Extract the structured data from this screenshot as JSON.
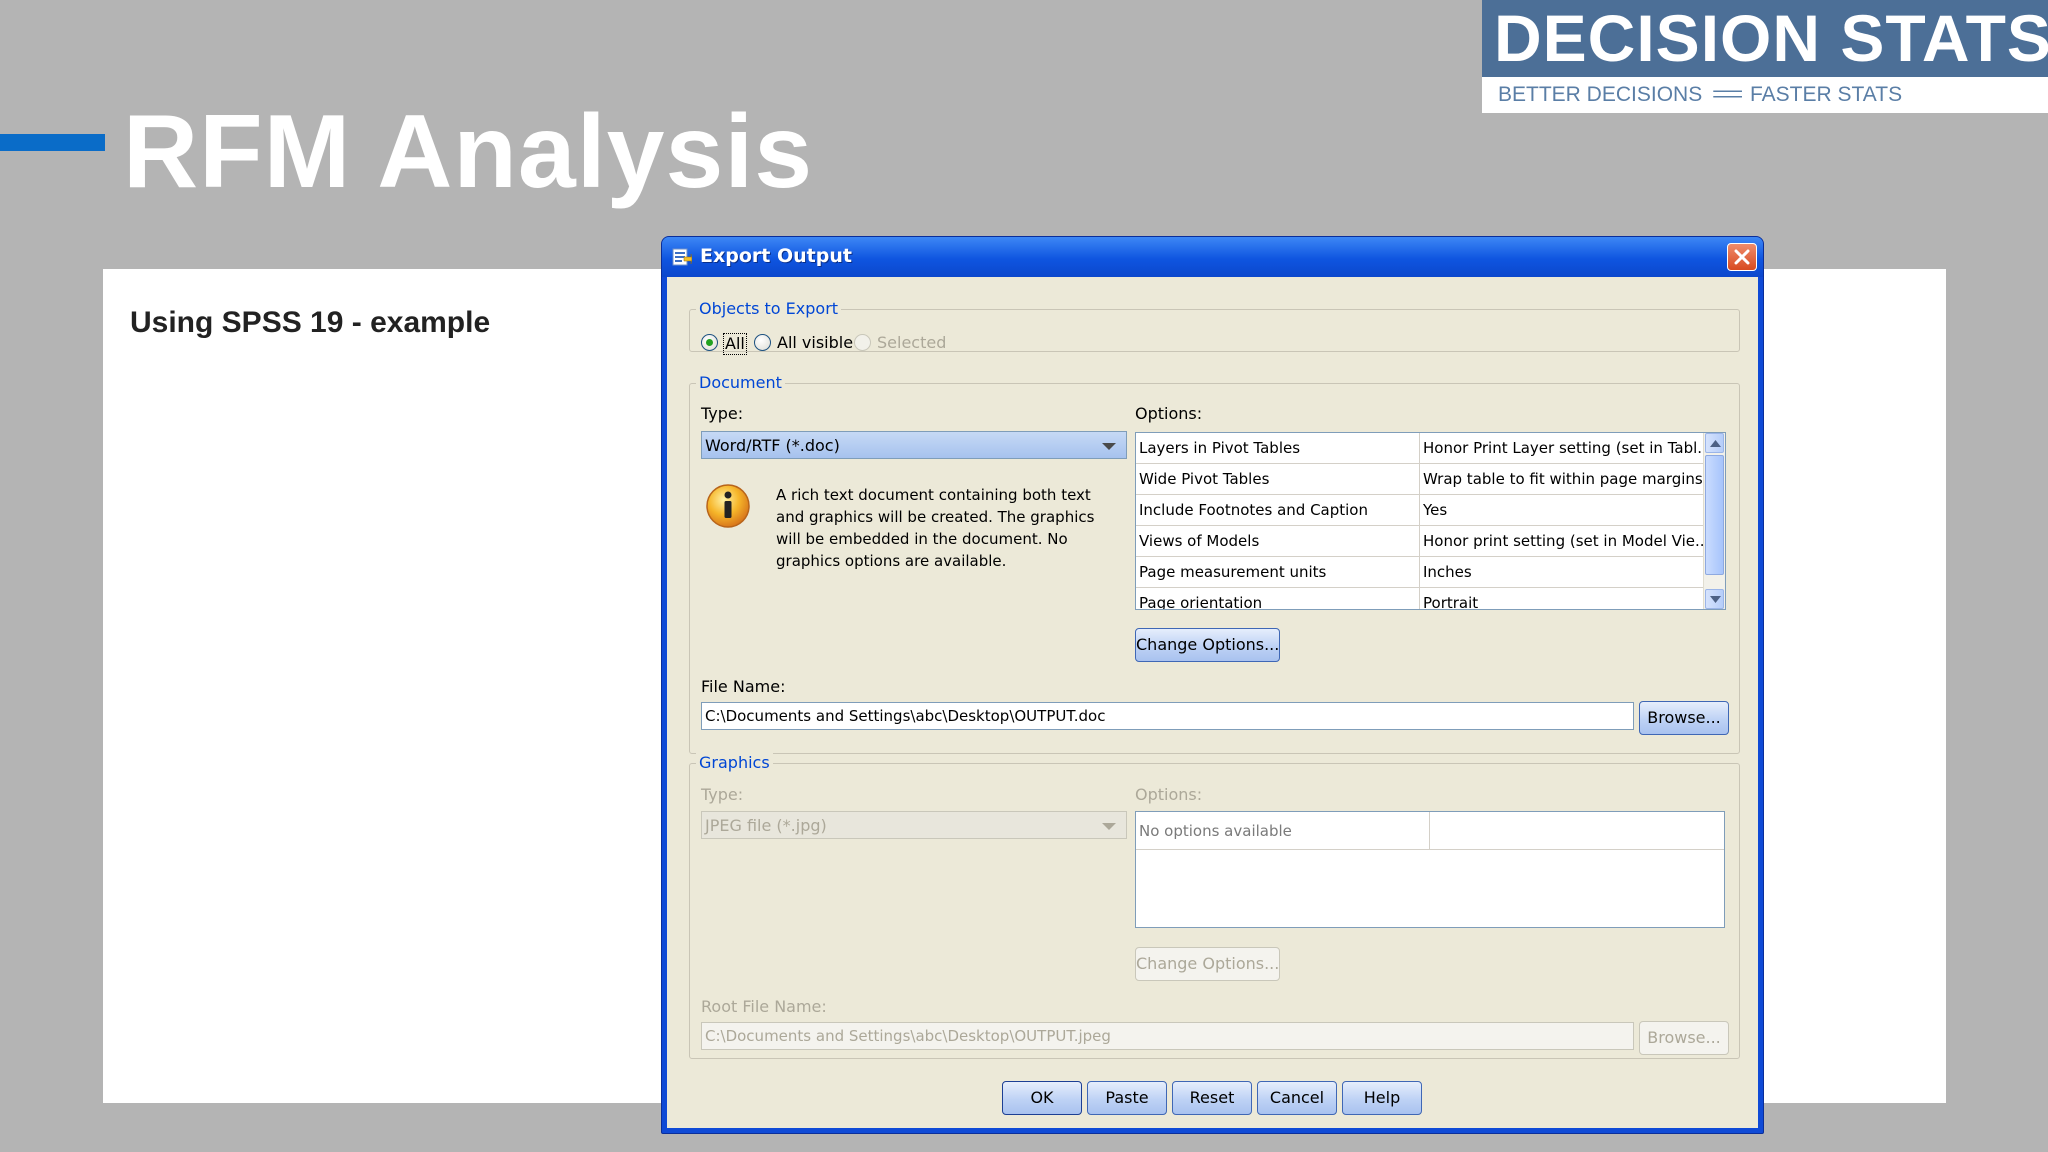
{
  "slide": {
    "title": "RFM Analysis",
    "subtitle": "Using SPSS 19 - example",
    "logo": {
      "main": "DECISION STATS",
      "left_tag": "BETTER DECISIONS",
      "separator": "===",
      "right_tag": "FASTER STATS"
    }
  },
  "dialog": {
    "title": "Export Output",
    "objects_to_export": {
      "legend": "Objects to Export",
      "options": [
        "All",
        "All visible",
        "Selected"
      ],
      "selected": "All"
    },
    "document": {
      "legend": "Document",
      "type_label": "Type:",
      "type_value": "Word/RTF (*.doc)",
      "info_text": "A rich text document containing both text and graphics will be created. The graphics will be embedded in the document. No graphics options are available.",
      "options_label": "Options:",
      "options_rows": [
        [
          "Layers in Pivot Tables",
          "Honor Print Layer setting (set in Tabl..."
        ],
        [
          "Wide Pivot Tables",
          "Wrap table to fit within page margins"
        ],
        [
          "Include Footnotes and Caption",
          "Yes"
        ],
        [
          "Views of Models",
          "Honor print setting (set in Model Vie..."
        ],
        [
          "Page measurement units",
          "Inches"
        ],
        [
          "Page orientation",
          "Portrait"
        ]
      ],
      "change_options": "Change Options...",
      "file_name_label": "File Name:",
      "file_name_value": "C:\\Documents and Settings\\abc\\Desktop\\OUTPUT.doc",
      "browse": "Browse..."
    },
    "graphics": {
      "legend": "Graphics",
      "type_label": "Type:",
      "type_value": "JPEG file (*.jpg)",
      "options_label": "Options:",
      "options_rows": [
        [
          "No options available",
          ""
        ]
      ],
      "change_options": "Change Options...",
      "root_file_label": "Root File Name:",
      "root_file_value": "C:\\Documents and Settings\\abc\\Desktop\\OUTPUT.jpeg",
      "browse": "Browse..."
    },
    "buttons": {
      "ok": "OK",
      "paste": "Paste",
      "reset": "Reset",
      "cancel": "Cancel",
      "help": "Help"
    }
  },
  "colors": {
    "background": "#b4b4b4",
    "accent": "#0a6cc8",
    "logo_blue": "#4c6f97",
    "dialog_frame": "#0f4ad6",
    "dialog_face": "#ece9d8"
  },
  "icons": [
    "app-icon",
    "close-icon",
    "info-icon",
    "scroll-up-icon",
    "scroll-down-icon",
    "dropdown-arrow-icon"
  ]
}
